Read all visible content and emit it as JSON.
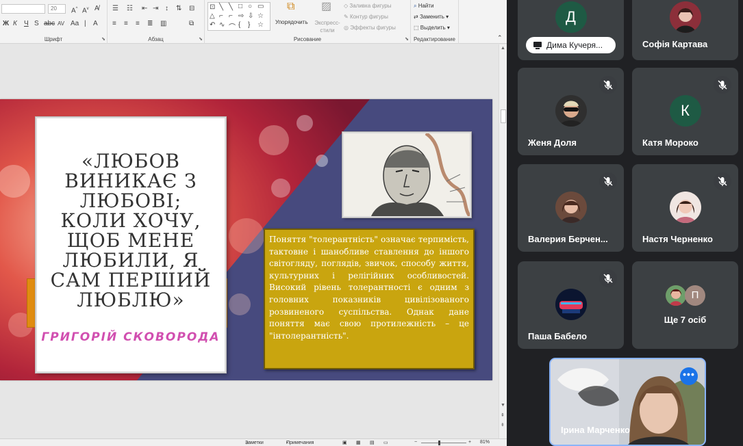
{
  "ribbon": {
    "font_name_value": "",
    "font_size_value": "20",
    "groups": {
      "font": "Шрифт",
      "paragraph": "Абзац",
      "drawing": "Рисование",
      "editing": "Редактирование"
    },
    "arrange_label": "Упорядочить",
    "quick_styles_label": "Экспресс-стили",
    "shape_fill_label": "Заливка фигуры",
    "shape_outline_label": "Контур фигуры",
    "shape_effects_label": "Эффекты фигуры",
    "find_label": "Найти",
    "replace_label": "Заменить",
    "select_label": "Выделить"
  },
  "status_bar": {
    "notes_label": "Заметки",
    "comments_label": "Примечания",
    "zoom_value": "81%"
  },
  "slide": {
    "quote_lines": [
      "«ЛЮБОВ",
      "ВИНИКАЄ З",
      "ЛЮБОВІ;",
      "КОЛИ ХОЧУ,",
      "ЩОБ МЕНЕ",
      "ЛЮБИЛИ, Я",
      "САМ ПЕРШИЙ",
      "ЛЮБЛЮ»"
    ],
    "author": "ГРИГОРІЙ СКОВОРОДА",
    "text_box": "Поняття \"толерантність\" означає терпимість, тактовне і шанобливе ставлення до іншого світогляду, поглядів, звичок, способу життя, культурних і релігійних особливостей. Високий рівень толерантності є одним з головних показників цивілізованого розвиненого суспільства. Однак дане поняття має свою протилежність – це \"інтолерантність\"."
  },
  "meet": {
    "participants": [
      {
        "name": "Дима Кучеря...",
        "avatar_letter": "Д",
        "avatar_color": "#1e5a44"
      },
      {
        "name": "Софія Картава"
      },
      {
        "name": "Женя Доля"
      },
      {
        "name": "Катя Мороко",
        "avatar_letter": "К",
        "avatar_color": "#1e5a44"
      },
      {
        "name": "Валерия Берчен..."
      },
      {
        "name": "Настя Черненко"
      },
      {
        "name": "Паша Бабело"
      }
    ],
    "more_tile": {
      "label": "Ще 7 осіб",
      "mini_letter": "П",
      "mini_color": "#a1887f"
    },
    "self_name": "Ірина Марченко",
    "accent": "#1a73e8",
    "mic_icon": "mic-off-icon"
  }
}
